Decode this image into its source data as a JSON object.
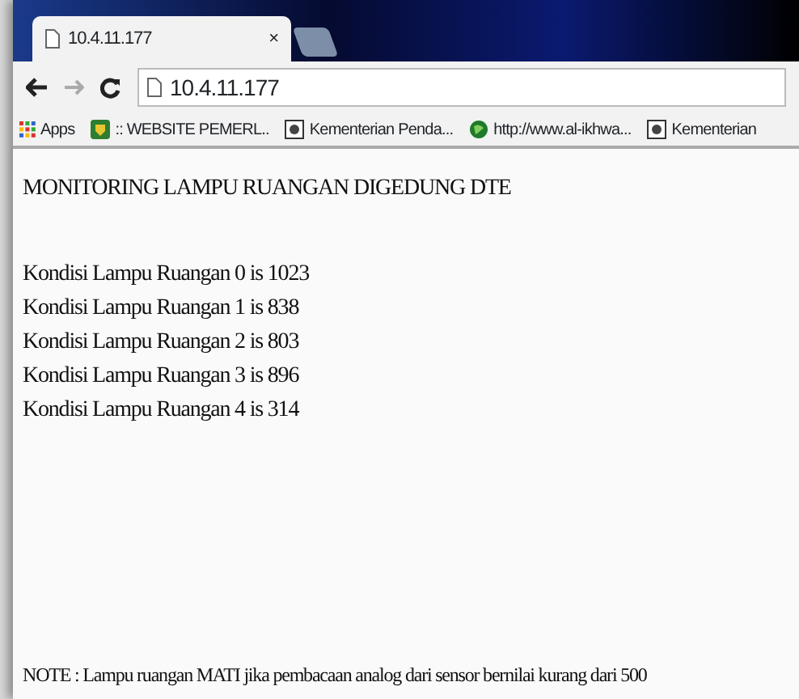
{
  "tab": {
    "title": "10.4.11.177",
    "close": "×"
  },
  "address_bar": {
    "value": "10.4.11.177"
  },
  "bookmarks": [
    {
      "label": "Apps",
      "kind": "apps"
    },
    {
      "label": ":: WEBSITE PEMERL..",
      "kind": "shield"
    },
    {
      "label": "Kementerian Penda...",
      "kind": "emblem"
    },
    {
      "label": "http://www.al-ikhwa...",
      "kind": "globe"
    },
    {
      "label": "Kementerian",
      "kind": "emblem"
    }
  ],
  "page": {
    "heading": "MONITORING LAMPU RUANGAN DIGEDUNG DTE",
    "readings": [
      "Kondisi Lampu Ruangan 0 is 1023",
      "Kondisi Lampu Ruangan 1 is 838",
      "Kondisi Lampu Ruangan 2 is 803",
      "Kondisi Lampu Ruangan 3 is 896",
      "Kondisi Lampu Ruangan 4 is 314"
    ],
    "note": "NOTE : Lampu ruangan MATI jika pembacaan analog dari sensor bernilai kurang dari 500"
  }
}
